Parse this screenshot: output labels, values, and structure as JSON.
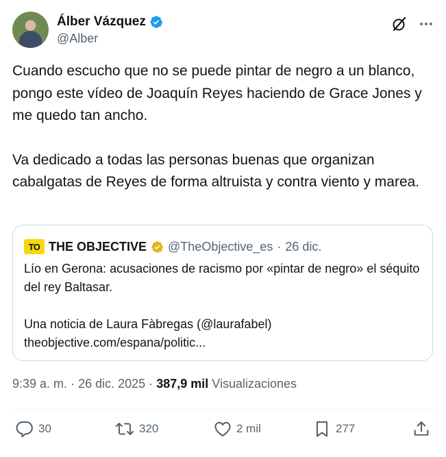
{
  "author": {
    "name": "Álber Vázquez",
    "handle": "@Alber"
  },
  "tweet": {
    "paragraph1": "Cuando escucho que no se puede pintar de negro a un blanco, pongo este vídeo de Joaquín Reyes haciendo de Grace Jones y me quedo tan ancho.",
    "paragraph2": "Va dedicado a todas las personas buenas que organizan cabalgatas de Reyes de forma altruista y contra viento y marea."
  },
  "quote": {
    "logo_text": "TO",
    "name": "THE OBJECTIVE",
    "handle": "@TheObjective_es",
    "separator": "·",
    "date": "26 dic.",
    "text1": "Lío en Gerona: acusaciones de racismo por «pintar de negro» el séquito del rey Baltasar.",
    "text2": "Una noticia de Laura Fàbregas (@laurafabel)",
    "link": "theobjective.com/espana/politic..."
  },
  "meta": {
    "time": "9:39 a. m.",
    "separator1": "·",
    "date": "26 dic. 2025",
    "separator2": "·",
    "views_count": "387,9 mil",
    "views_label": "Visualizaciones"
  },
  "actions": {
    "replies": "30",
    "reposts": "320",
    "likes": "2 mil",
    "bookmarks": "277"
  },
  "icons": {
    "verified": "verified-badge-icon",
    "quote_verified": "gold-verified-badge-icon",
    "grok": "grok-icon",
    "more": "more-icon",
    "reply": "reply-icon",
    "repost": "repost-icon",
    "like": "like-icon",
    "bookmark": "bookmark-icon",
    "share": "share-icon"
  },
  "colors": {
    "text": "#0f1419",
    "secondary": "#536471",
    "verified_blue": "#1d9bf0",
    "verified_gold": "#e2b719",
    "logo_yellow": "#f5d90a",
    "border": "#cfd9de"
  }
}
